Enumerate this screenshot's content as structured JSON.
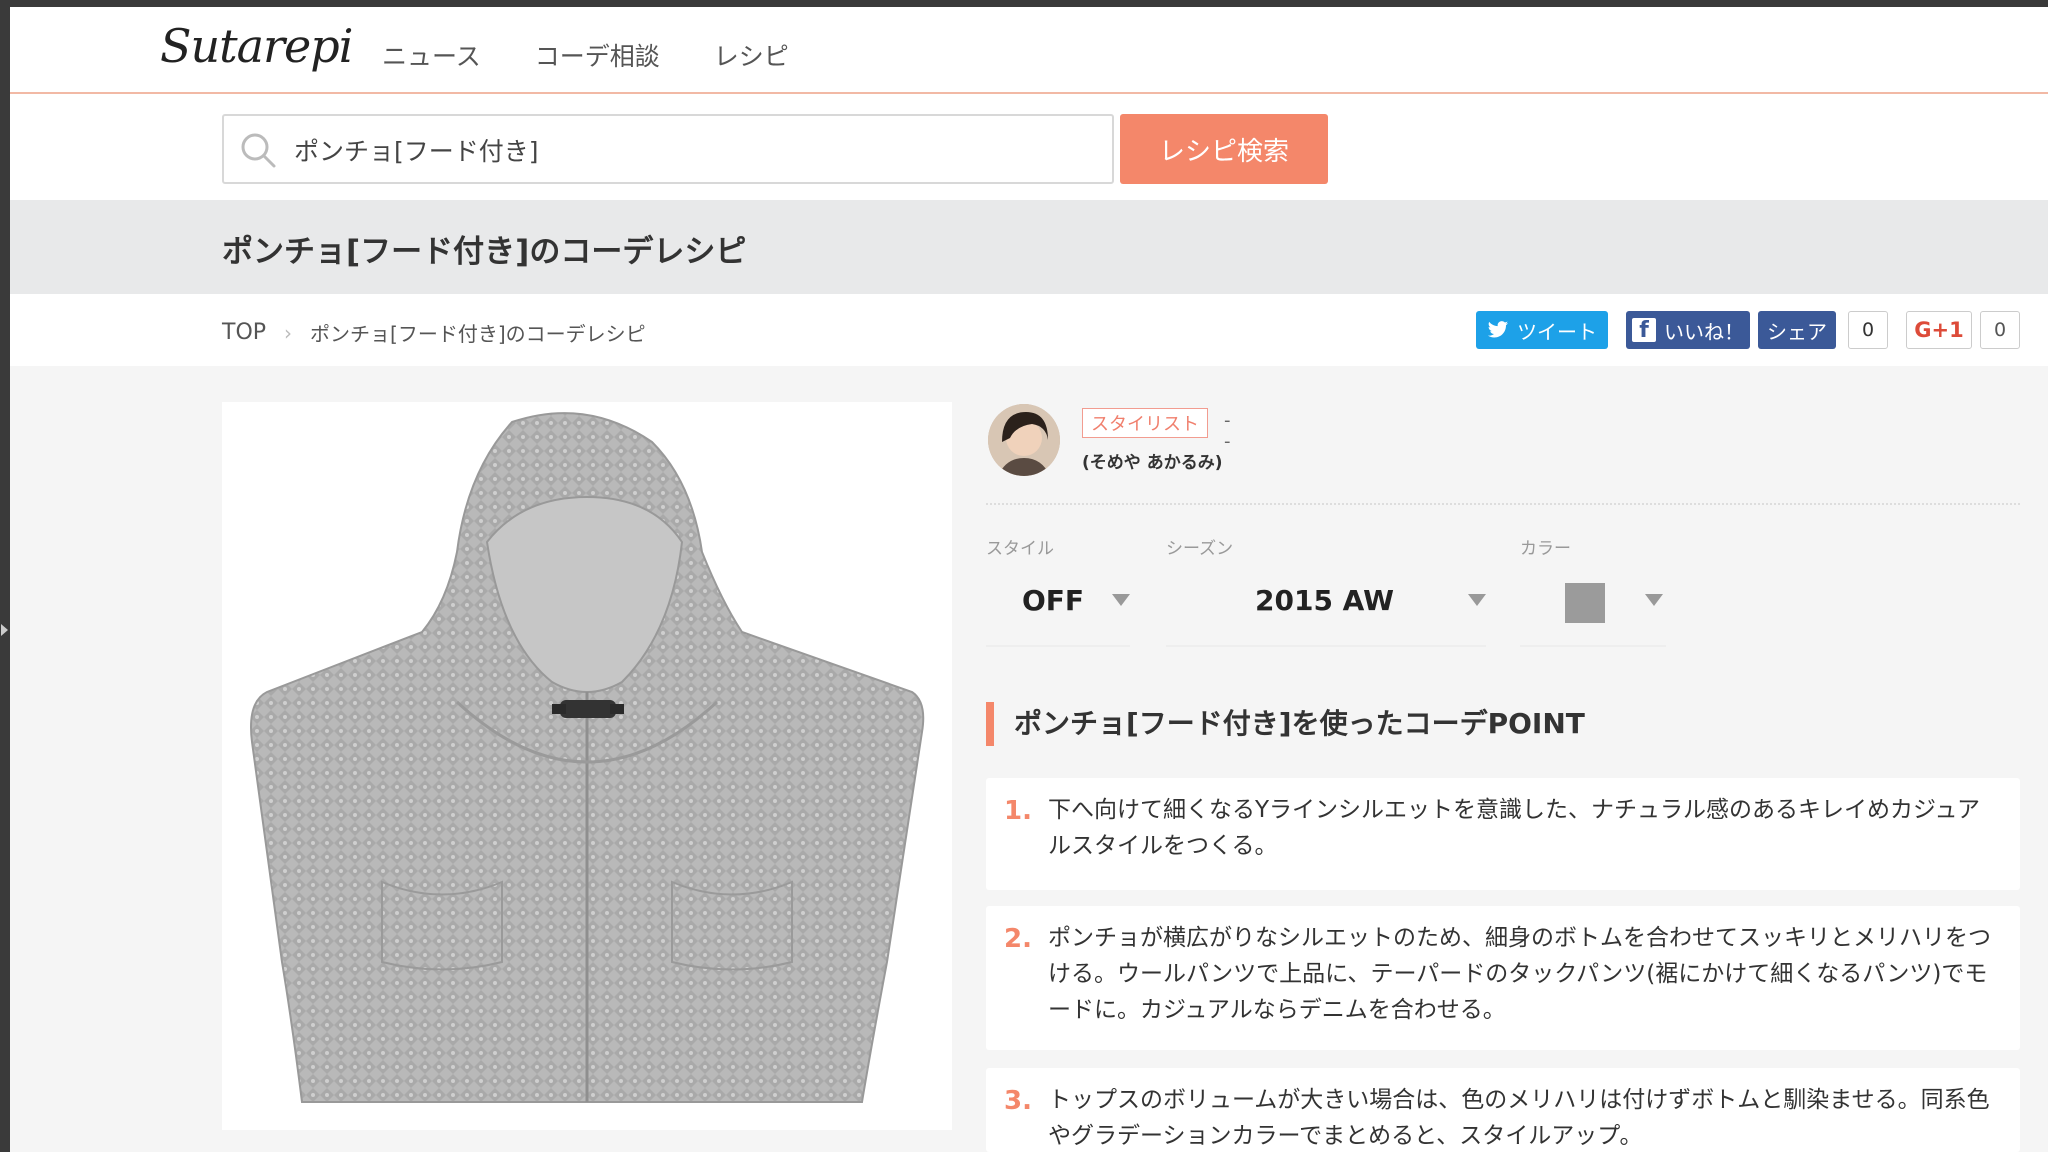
{
  "header": {
    "logo": "Sutarepi",
    "nav": [
      "ニュース",
      "コーデ相談",
      "レシピ"
    ]
  },
  "search": {
    "value": "ポンチョ[フード付き]",
    "button_label": "レシピ検索"
  },
  "page": {
    "title_bold": "ポンチョ[フード付き]",
    "title_rest": "のコーデレシピ"
  },
  "breadcrumb": {
    "top": "TOP",
    "current": "ポンチョ[フード付き]のコーデレシピ"
  },
  "social": {
    "tweet": "ツイート",
    "like": "いいね！",
    "share": "シェア",
    "share_count": "0",
    "gplus": "G+1",
    "gplus_count": "0"
  },
  "stylist": {
    "role": "スタイリスト",
    "dash": "- -",
    "name": "(そめや あかるみ)"
  },
  "filters": {
    "style_label": "スタイル",
    "style_value": "OFF",
    "season_label": "シーズン",
    "season_value": "2015 AW",
    "color_label": "カラー",
    "color_value": "#9b9b9b"
  },
  "points": {
    "heading_bold": "ポンチョ[フード付き]",
    "heading_rest": "を使ったコーデPOINT",
    "items": [
      {
        "num": "1.",
        "text": "下へ向けて細くなるYラインシルエットを意識した、ナチュラル感のあるキレイめカジュアルスタイルをつくる。"
      },
      {
        "num": "2.",
        "text": "ポンチョが横広がりなシルエットのため、細身のボトムを合わせてスッキリとメリハリをつける。ウールパンツで上品に、テーパードのタックパンツ(裾にかけて細くなるパンツ)でモードに。カジュアルならデニムを合わせる。"
      },
      {
        "num": "3.",
        "text": "トップスのボリュームが大きい場合は、色のメリハリは付けずボトムと馴染ませる。同系色やグラデーションカラーでまとめると、スタイルアップ。"
      }
    ]
  },
  "colors": {
    "accent": "#f4876a",
    "twitter": "#1da1e8",
    "facebook": "#3b5998"
  }
}
